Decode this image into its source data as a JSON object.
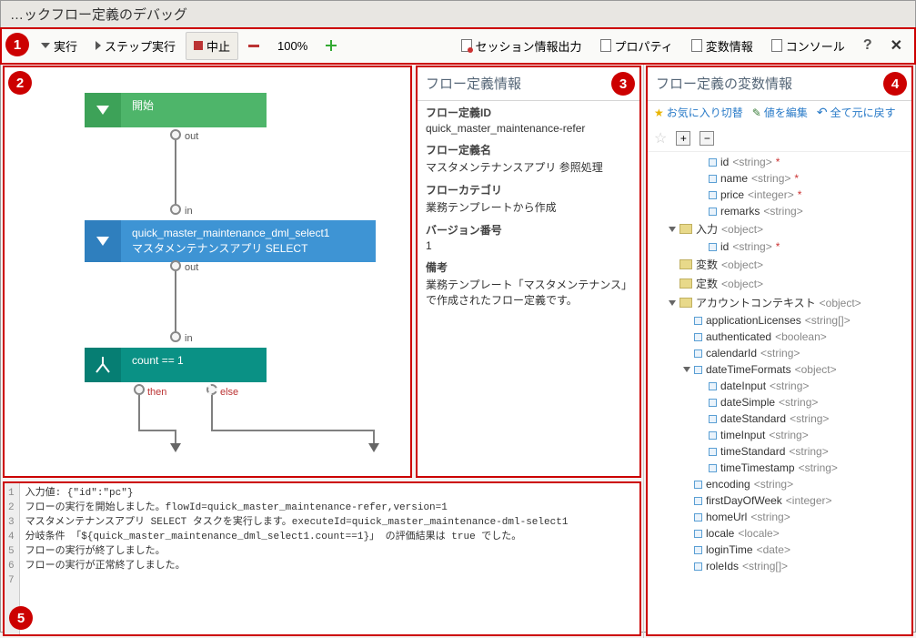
{
  "header": {
    "title": "…ックフロー定義のデバッグ"
  },
  "toolbar": {
    "run": "実行",
    "step": "ステップ実行",
    "stop": "中止",
    "zoom": "100%",
    "session": "セッション情報出力",
    "prop": "プロパティ",
    "vars": "変数情報",
    "console": "コンソール"
  },
  "flow": {
    "start": "開始",
    "sel_id": "quick_master_maintenance_dml_select1",
    "sel_name": "マスタメンテナンスアプリ SELECT",
    "cond": "count == 1",
    "out": "out",
    "in": "in",
    "then": "then",
    "else": "else"
  },
  "info": {
    "title": "フロー定義情報",
    "id_lbl": "フロー定義ID",
    "id_val": "quick_master_maintenance-refer",
    "name_lbl": "フロー定義名",
    "name_val": "マスタメンテナンスアプリ 参照処理",
    "cat_lbl": "フローカテゴリ",
    "cat_val": "業務テンプレートから作成",
    "ver_lbl": "バージョン番号",
    "ver_val": "1",
    "note_lbl": "備考",
    "note_val": "業務テンプレート「マスタメンテナンス」で作成されたフロー定義です。"
  },
  "varpane": {
    "title": "フロー定義の変数情報",
    "fav": "お気に入り切替",
    "edit": "値を編集",
    "reset": "全て元に戻す",
    "tree": [
      {
        "d": 3,
        "dot": 1,
        "n": "id",
        "t": "<string>",
        "r": 1
      },
      {
        "d": 3,
        "dot": 1,
        "n": "name",
        "t": "<string>",
        "r": 1
      },
      {
        "d": 3,
        "dot": 1,
        "n": "price",
        "t": "<integer>",
        "r": 1
      },
      {
        "d": 3,
        "dot": 1,
        "n": "remarks",
        "t": "<string>"
      },
      {
        "d": 1,
        "tw": "o",
        "fol": 1,
        "n": "入力",
        "t": "<object>"
      },
      {
        "d": 3,
        "dot": 1,
        "n": "id",
        "t": "<string>",
        "r": 1
      },
      {
        "d": 1,
        "fol": 1,
        "n": "変数",
        "t": "<object>"
      },
      {
        "d": 1,
        "fol": 1,
        "n": "定数",
        "t": "<object>"
      },
      {
        "d": 1,
        "tw": "o",
        "fol": 1,
        "n": "アカウントコンテキスト",
        "t": "<object>"
      },
      {
        "d": 2,
        "dot": 1,
        "n": "applicationLicenses",
        "t": "<string[]>"
      },
      {
        "d": 2,
        "dot": 1,
        "n": "authenticated",
        "t": "<boolean>"
      },
      {
        "d": 2,
        "dot": 1,
        "n": "calendarId",
        "t": "<string>"
      },
      {
        "d": 2,
        "tw": "o",
        "dot": 1,
        "n": "dateTimeFormats",
        "t": "<object>"
      },
      {
        "d": 3,
        "dot": 1,
        "n": "dateInput",
        "t": "<string>"
      },
      {
        "d": 3,
        "dot": 1,
        "n": "dateSimple",
        "t": "<string>"
      },
      {
        "d": 3,
        "dot": 1,
        "n": "dateStandard",
        "t": "<string>"
      },
      {
        "d": 3,
        "dot": 1,
        "n": "timeInput",
        "t": "<string>"
      },
      {
        "d": 3,
        "dot": 1,
        "n": "timeStandard",
        "t": "<string>"
      },
      {
        "d": 3,
        "dot": 1,
        "n": "timeTimestamp",
        "t": "<string>"
      },
      {
        "d": 2,
        "dot": 1,
        "n": "encoding",
        "t": "<string>"
      },
      {
        "d": 2,
        "dot": 1,
        "n": "firstDayOfWeek",
        "t": "<integer>"
      },
      {
        "d": 2,
        "dot": 1,
        "n": "homeUrl",
        "t": "<string>"
      },
      {
        "d": 2,
        "dot": 1,
        "n": "locale",
        "t": "<locale>"
      },
      {
        "d": 2,
        "dot": 1,
        "n": "loginTime",
        "t": "<date>"
      },
      {
        "d": 2,
        "dot": 1,
        "n": "roleIds",
        "t": "<string[]>"
      }
    ]
  },
  "console": {
    "lines": [
      "入力値: {\"id\":\"pc\"}",
      "フローの実行を開始しました。flowId=quick_master_maintenance-refer,version=1",
      "マスタメンテナンスアプリ SELECT タスクを実行します。executeId=quick_master_maintenance-dml-select1",
      "分岐条件 「${quick_master_maintenance_dml_select1.count==1}」 の評価結果は true でした。",
      "フローの実行が終了しました。",
      "フローの実行が正常終了しました。",
      ""
    ]
  },
  "badges": {
    "b1": "1",
    "b2": "2",
    "b3": "3",
    "b4": "4",
    "b5": "5"
  }
}
